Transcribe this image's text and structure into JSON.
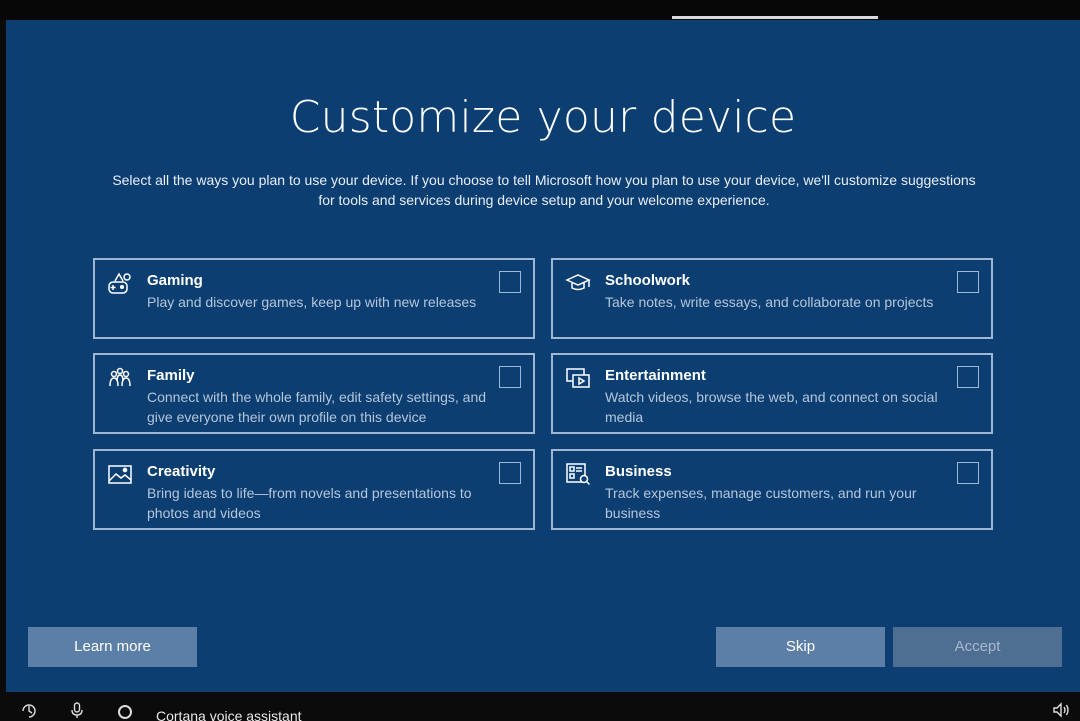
{
  "header": {
    "title": "Customize your device",
    "subtitle": "Select all the ways you plan to use your device. If you choose to tell Microsoft how you plan to use your device, we'll customize suggestions for tools and services during device setup and your welcome experience."
  },
  "cards": [
    {
      "icon": "gaming-icon",
      "title": "Gaming",
      "description": "Play and discover games, keep up with new releases",
      "checked": false
    },
    {
      "icon": "schoolwork-icon",
      "title": "Schoolwork",
      "description": "Take notes, write essays, and collaborate on projects",
      "checked": false
    },
    {
      "icon": "family-icon",
      "title": "Family",
      "description": "Connect with the whole family, edit safety settings, and give everyone their own profile on this device",
      "checked": false
    },
    {
      "icon": "entertainment-icon",
      "title": "Entertainment",
      "description": "Watch videos, browse the web, and connect on social media",
      "checked": false
    },
    {
      "icon": "creativity-icon",
      "title": "Creativity",
      "description": "Bring ideas to life—from novels and presentations to photos and videos",
      "checked": false
    },
    {
      "icon": "business-icon",
      "title": "Business",
      "description": "Track expenses, manage customers, and run your business",
      "checked": false
    }
  ],
  "buttons": {
    "learn_more": "Learn more",
    "skip": "Skip",
    "accept": "Accept"
  },
  "taskbar": {
    "cortana_label": "Cortana voice assistant"
  },
  "colors": {
    "panel_bg": "#0c3e72",
    "card_border": "#9fb7d1",
    "button_bg": "#5b7fa6"
  }
}
